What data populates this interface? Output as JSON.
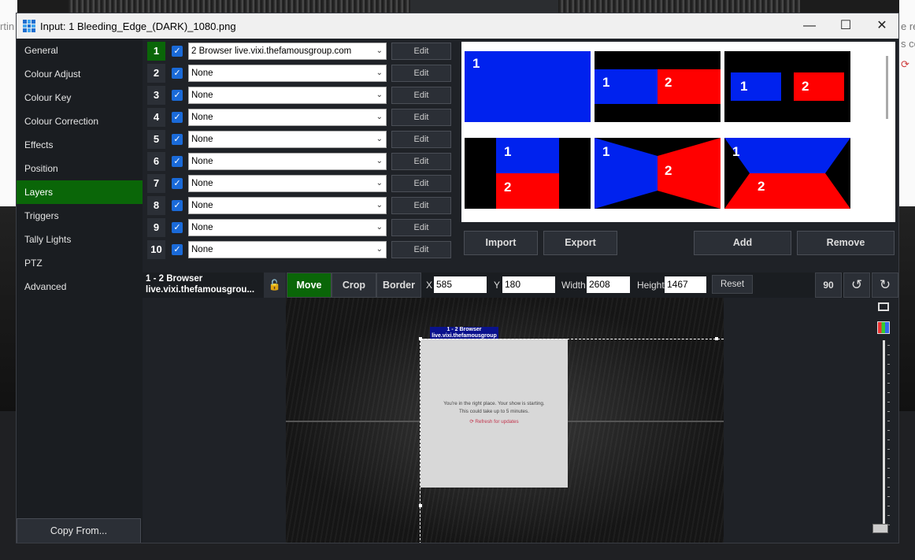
{
  "window": {
    "title": "Input: 1 Bleeding_Edge_(DARK)_1080.png",
    "controls": [
      "—",
      "☐",
      "✕"
    ]
  },
  "background": {
    "left_text": "rtin",
    "right_text_1": "e re",
    "right_text_2": "s co",
    "right_icon": "⟳"
  },
  "sidebar": {
    "items": [
      {
        "label": "General"
      },
      {
        "label": "Colour Adjust"
      },
      {
        "label": "Colour Key"
      },
      {
        "label": "Colour Correction"
      },
      {
        "label": "Effects"
      },
      {
        "label": "Position"
      },
      {
        "label": "Layers"
      },
      {
        "label": "Triggers"
      },
      {
        "label": "Tally Lights"
      },
      {
        "label": "PTZ"
      },
      {
        "label": "Advanced"
      }
    ],
    "active": "Layers",
    "copy_from": "Copy From..."
  },
  "layers": [
    {
      "num": "1",
      "checked": true,
      "source": "2 Browser live.vixi.thefamousgroup.com",
      "edit": "Edit"
    },
    {
      "num": "2",
      "checked": true,
      "source": "None",
      "edit": "Edit"
    },
    {
      "num": "3",
      "checked": true,
      "source": "None",
      "edit": "Edit"
    },
    {
      "num": "4",
      "checked": true,
      "source": "None",
      "edit": "Edit"
    },
    {
      "num": "5",
      "checked": true,
      "source": "None",
      "edit": "Edit"
    },
    {
      "num": "6",
      "checked": true,
      "source": "None",
      "edit": "Edit"
    },
    {
      "num": "7",
      "checked": true,
      "source": "None",
      "edit": "Edit"
    },
    {
      "num": "8",
      "checked": true,
      "source": "None",
      "edit": "Edit"
    },
    {
      "num": "9",
      "checked": true,
      "source": "None",
      "edit": "Edit"
    },
    {
      "num": "10",
      "checked": true,
      "source": "None",
      "edit": "Edit"
    }
  ],
  "layouts": {
    "thumbs": [
      {
        "labels": [
          "1"
        ]
      },
      {
        "labels": [
          "1",
          "2"
        ]
      },
      {
        "labels": [
          "1",
          "2"
        ]
      },
      {
        "labels": [
          "1",
          "2"
        ]
      },
      {
        "labels": [
          "1",
          "2"
        ]
      },
      {
        "labels": [
          "1",
          "2"
        ]
      }
    ],
    "colors": {
      "blue": "#0022ee",
      "red": "#ff0000",
      "black": "#000000"
    },
    "buttons": {
      "import": "Import",
      "export": "Export",
      "add": "Add",
      "remove": "Remove"
    }
  },
  "toolbar": {
    "selected_line1": "1 - 2 Browser",
    "selected_line2": "live.vixi.thefamousgrou...",
    "lock_icon": "unlock-icon",
    "modes": {
      "move": "Move",
      "crop": "Crop",
      "border": "Border"
    },
    "x_label": "X",
    "x": "585",
    "y_label": "Y",
    "y": "180",
    "width_label": "Width",
    "width": "2608",
    "height_label": "Height",
    "height": "1467",
    "reset": "Reset",
    "rotate90": "90"
  },
  "preview": {
    "label_line1": "1 - 2 Browser",
    "label_line2": "live.vixi.thefamousgroup",
    "message_line1": "You're in the right place. Your show is starting.",
    "message_line2": "This could take up to 5 minutes.",
    "refresh": "⟳  Refresh for updates"
  },
  "accent": {
    "active_green": "#0a6608",
    "checkbox_blue": "#1a6ad8"
  }
}
